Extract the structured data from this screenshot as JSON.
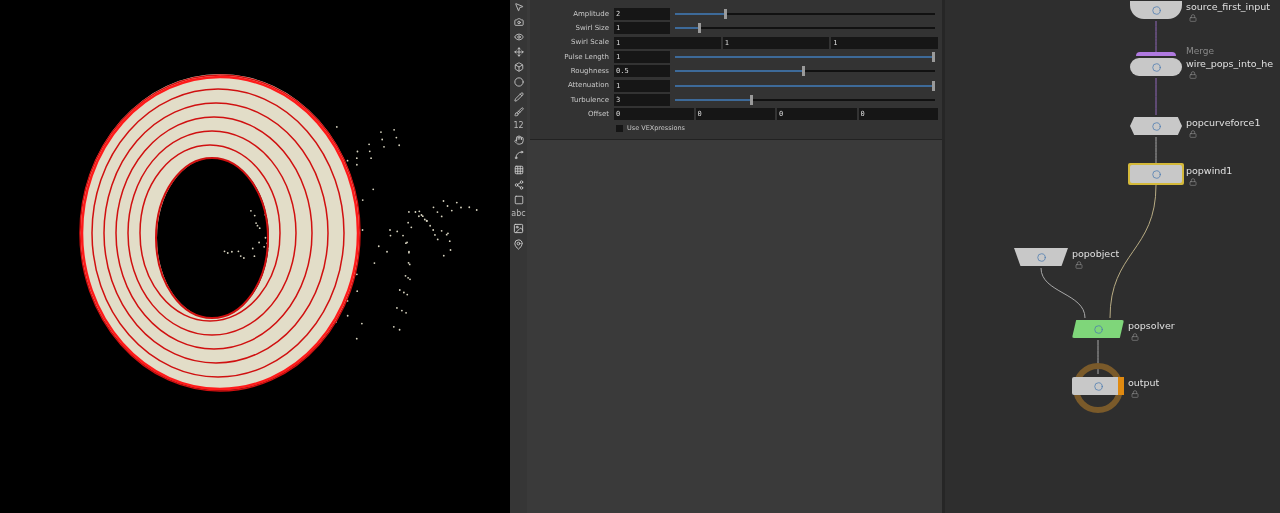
{
  "toolbar": {
    "labels": [
      {
        "kind": "digits",
        "text": "12"
      },
      {
        "kind": "word",
        "text": "abc"
      }
    ]
  },
  "parameters": [
    {
      "kind": "slider",
      "label": "Amplitude",
      "value": "2",
      "level": 0.2
    },
    {
      "kind": "slider",
      "label": "Swirl Size",
      "value": "1",
      "level": 0.1
    },
    {
      "kind": "vector",
      "label": "Swirl Scale",
      "values": [
        "1",
        "1",
        "1"
      ]
    },
    {
      "kind": "slider",
      "label": "Pulse Length",
      "value": "1",
      "level": 1
    },
    {
      "kind": "slider",
      "label": "Roughness",
      "value": "0.5",
      "level": 0.5
    },
    {
      "kind": "slider",
      "label": "Attenuation",
      "value": "1",
      "level": 1
    },
    {
      "kind": "slider",
      "label": "Turbulence",
      "value": "3",
      "level": 0.3
    },
    {
      "kind": "vector",
      "label": "Offset",
      "values": [
        "0",
        "0",
        "0",
        "0"
      ]
    },
    {
      "kind": "checkbox",
      "label": "Use VEXpressions",
      "checked": false
    }
  ],
  "network": {
    "nodes": [
      {
        "kind": "source",
        "name": "source_first_input",
        "selected": false,
        "color": "#c8c8c8"
      },
      {
        "kind": "merge",
        "name": "wire_pops_into_he",
        "type_label": "Merge",
        "selected": false,
        "color": "#c8c8c8"
      },
      {
        "kind": "hex",
        "name": "popcurveforce1",
        "selected": false,
        "color": "#c8c8c8"
      },
      {
        "kind": "flat",
        "name": "popwind1",
        "selected": true,
        "color": "#c8c8c8"
      },
      {
        "kind": "trapezoid",
        "name": "popobject",
        "selected": false,
        "color": "#c8c8c8"
      },
      {
        "kind": "parallelogram",
        "name": "popsolver",
        "selected": false,
        "color": "#7fd67a"
      },
      {
        "kind": "output",
        "name": "output",
        "selected": false,
        "color": "#c8c8c8"
      }
    ]
  }
}
